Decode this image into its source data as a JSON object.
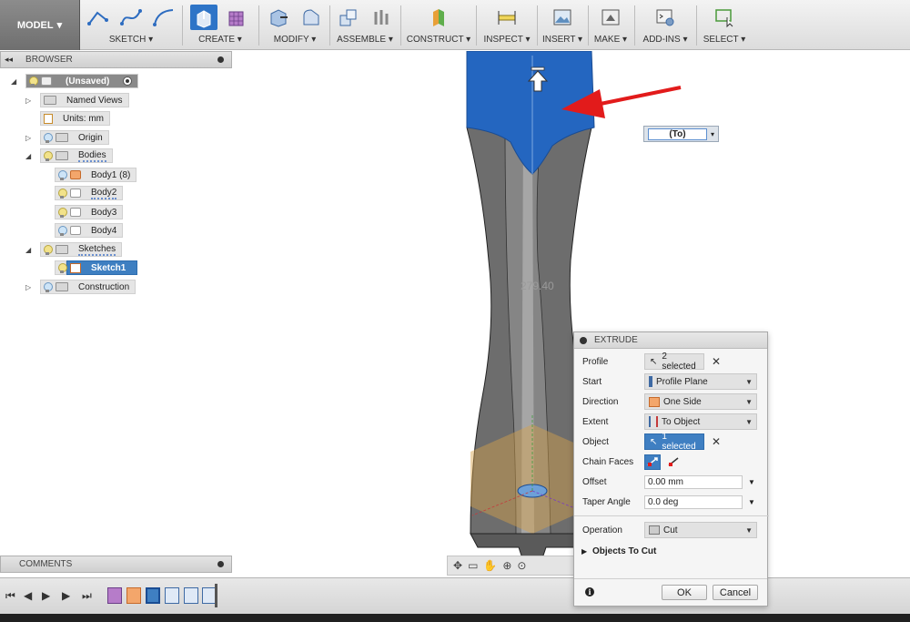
{
  "toolbar": {
    "workspace": "MODEL",
    "groups": {
      "sketch": "SKETCH",
      "create": "CREATE",
      "modify": "MODIFY",
      "assemble": "ASSEMBLE",
      "construct": "CONSTRUCT",
      "inspect": "INSPECT",
      "insert": "INSERT",
      "make": "MAKE",
      "addins": "ADD-INS",
      "select": "SELECT"
    },
    "dropdown_glyph": "▾"
  },
  "browser": {
    "title": "BROWSER",
    "collapse_glyph": "◂◂",
    "items": {
      "root": "(Unsaved)",
      "named_views": "Named Views",
      "units": "Units: mm",
      "origin": "Origin",
      "bodies": "Bodies",
      "body1": "Body1 (8)",
      "body2": "Body2",
      "body3": "Body3",
      "body4": "Body4",
      "sketches": "Sketches",
      "sketch1": "Sketch1",
      "construction": "Construction"
    },
    "expand_glyph": "▷",
    "expanded_glyph": "◢"
  },
  "comments": {
    "title": "COMMENTS"
  },
  "canvas": {
    "dimension_value": "(To)",
    "dimension_label": "279.40"
  },
  "extrude": {
    "title": "EXTRUDE",
    "rows": {
      "profile_label": "Profile",
      "profile_value": "2 selected",
      "start_label": "Start",
      "start_value": "Profile Plane",
      "direction_label": "Direction",
      "direction_value": "One Side",
      "extent_label": "Extent",
      "extent_value": "To Object",
      "object_label": "Object",
      "object_value": "1 selected",
      "chain_label": "Chain Faces",
      "offset_label": "Offset",
      "offset_value": "0.00 mm",
      "taper_label": "Taper Angle",
      "taper_value": "0.0 deg",
      "operation_label": "Operation",
      "operation_value": "Cut",
      "objects_to_cut": "Objects To Cut"
    },
    "ok": "OK",
    "cancel": "Cancel",
    "clear_glyph": "✕",
    "info_glyph": "i"
  },
  "colors": {
    "accent": "#3f7fc2",
    "model_body": "#6b6b6b",
    "selected_face": "#2466c0",
    "arrow_red": "#e21b1b"
  }
}
